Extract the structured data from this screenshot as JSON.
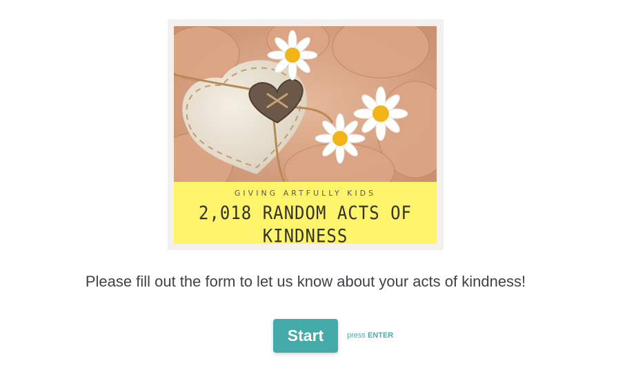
{
  "hero": {
    "org_name": "GIVING ARTFULLY KIDS",
    "title": "2,018 RANDOM ACTS OF KINDNESS",
    "banner_color": "#fdf46b",
    "image_description_icons": [
      "fabric-heart-icon",
      "wooden-heart-button-icon",
      "daisy-icon"
    ]
  },
  "intro": {
    "text": "Please fill out the form to let us know about your acts of kindness!"
  },
  "actions": {
    "start_label": "Start",
    "press_prefix": "press",
    "press_key": "ENTER",
    "accent_color": "#45aba8"
  }
}
